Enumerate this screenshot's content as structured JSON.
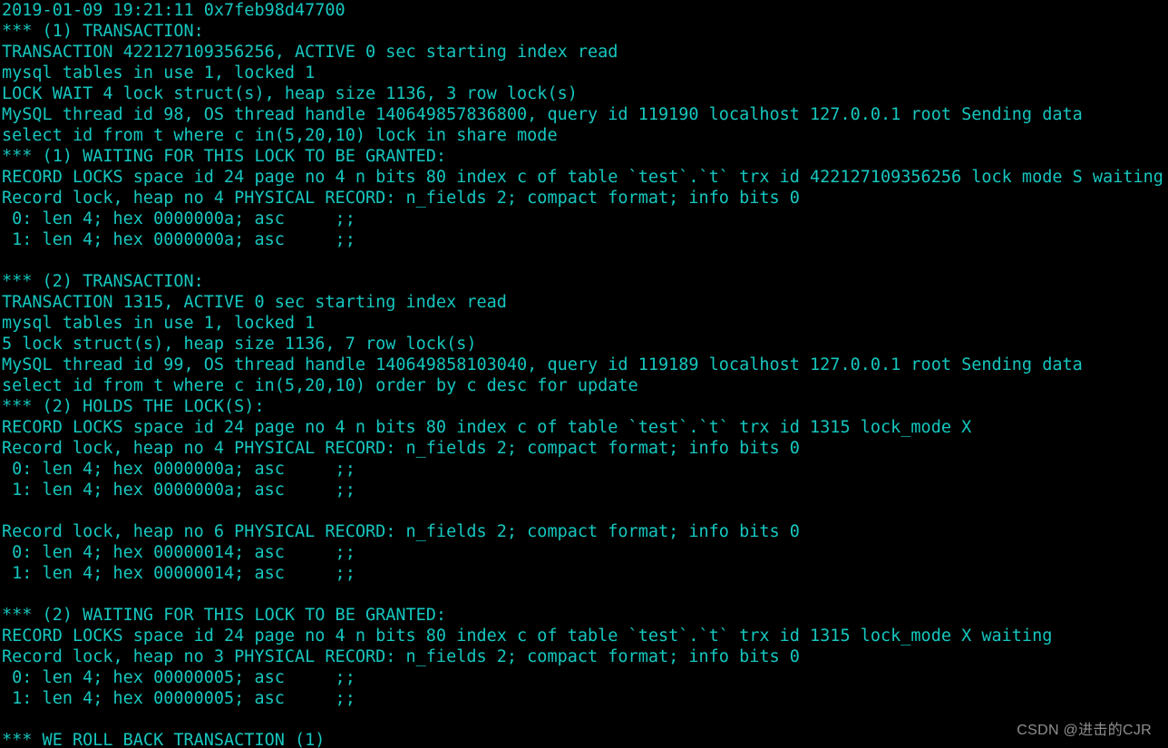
{
  "lines": [
    "2019-01-09 19:21:11 0x7feb98d47700",
    "*** (1) TRANSACTION:",
    "TRANSACTION 422127109356256, ACTIVE 0 sec starting index read",
    "mysql tables in use 1, locked 1",
    "LOCK WAIT 4 lock struct(s), heap size 1136, 3 row lock(s)",
    "MySQL thread id 98, OS thread handle 140649857836800, query id 119190 localhost 127.0.0.1 root Sending data",
    "select id from t where c in(5,20,10) lock in share mode",
    "*** (1) WAITING FOR THIS LOCK TO BE GRANTED:",
    "RECORD LOCKS space id 24 page no 4 n bits 80 index c of table `test`.`t` trx id 422127109356256 lock mode S waiting",
    "Record lock, heap no 4 PHYSICAL RECORD: n_fields 2; compact format; info bits 0",
    " 0: len 4; hex 0000000a; asc     ;;",
    " 1: len 4; hex 0000000a; asc     ;;",
    "",
    "*** (2) TRANSACTION:",
    "TRANSACTION 1315, ACTIVE 0 sec starting index read",
    "mysql tables in use 1, locked 1",
    "5 lock struct(s), heap size 1136, 7 row lock(s)",
    "MySQL thread id 99, OS thread handle 140649858103040, query id 119189 localhost 127.0.0.1 root Sending data",
    "select id from t where c in(5,20,10) order by c desc for update",
    "*** (2) HOLDS THE LOCK(S):",
    "RECORD LOCKS space id 24 page no 4 n bits 80 index c of table `test`.`t` trx id 1315 lock_mode X",
    "Record lock, heap no 4 PHYSICAL RECORD: n_fields 2; compact format; info bits 0",
    " 0: len 4; hex 0000000a; asc     ;;",
    " 1: len 4; hex 0000000a; asc     ;;",
    "",
    "Record lock, heap no 6 PHYSICAL RECORD: n_fields 2; compact format; info bits 0",
    " 0: len 4; hex 00000014; asc     ;;",
    " 1: len 4; hex 00000014; asc     ;;",
    "",
    "*** (2) WAITING FOR THIS LOCK TO BE GRANTED:",
    "RECORD LOCKS space id 24 page no 4 n bits 80 index c of table `test`.`t` trx id 1315 lock_mode X waiting",
    "Record lock, heap no 3 PHYSICAL RECORD: n_fields 2; compact format; info bits 0",
    " 0: len 4; hex 00000005; asc     ;;",
    " 1: len 4; hex 00000005; asc     ;;",
    "",
    "*** WE ROLL BACK TRANSACTION (1)"
  ],
  "watermark": "CSDN @进击的CJR"
}
